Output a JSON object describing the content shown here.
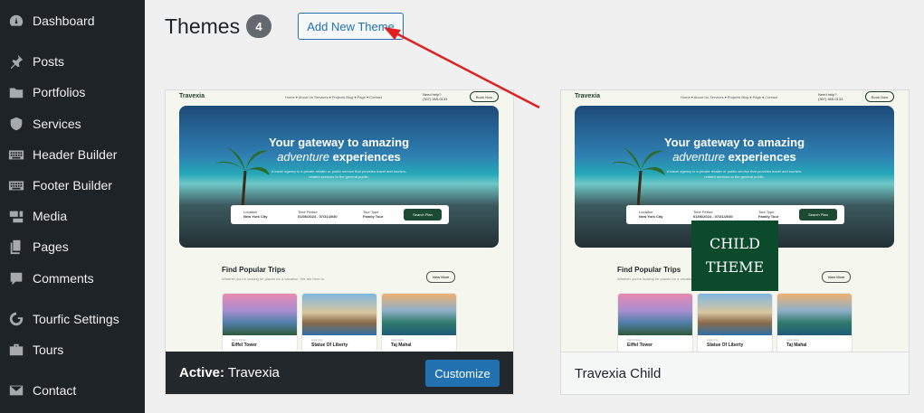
{
  "sidebar": {
    "items": [
      {
        "label": "Dashboard",
        "icon": "dashboard-icon"
      },
      {
        "label": "Posts",
        "icon": "pin-icon"
      },
      {
        "label": "Portfolios",
        "icon": "folder-icon"
      },
      {
        "label": "Services",
        "icon": "shield-icon"
      },
      {
        "label": "Header Builder",
        "icon": "keyboard-icon"
      },
      {
        "label": "Footer Builder",
        "icon": "keyboard-icon"
      },
      {
        "label": "Media",
        "icon": "media-icon"
      },
      {
        "label": "Pages",
        "icon": "pages-icon"
      },
      {
        "label": "Comments",
        "icon": "comment-icon"
      },
      {
        "label": "Tourfic Settings",
        "icon": "tourfic-icon"
      },
      {
        "label": "Tours",
        "icon": "briefcase-icon"
      },
      {
        "label": "Contact",
        "icon": "envelope-icon"
      }
    ]
  },
  "header": {
    "title": "Themes",
    "count": "4",
    "add_new_label": "Add New Theme"
  },
  "themes": [
    {
      "preview": {
        "logo": "Travexia",
        "nav_links": "Home ▾   About Us   Services ▾   Projects   Blog ▾   Page ▾   Contact",
        "help_label": "Need help?",
        "help_phone": "(307) 555-0133",
        "book_now": "Book Now",
        "hero_line1": "Your gateway to amazing",
        "hero_line2_italic": "adventure",
        "hero_line2": " experiences",
        "hero_sub": "A travel agency is a private retailer or public service that provides travel and tourism-related services to the general public.",
        "location_label": "Location",
        "location_value": "New York City",
        "time_label": "Time Period",
        "time_value": "01/06/2024 - 07/31/2030",
        "type_label": "Tour Type",
        "type_value": "Family Tour",
        "search_button": "Search Plan",
        "trips_title": "Find Popular Trips",
        "trips_sub": "Whether you're looking for places for a vacation. We are here to",
        "view_more": "View More",
        "cards": [
          {
            "category": "Kerry Ficus",
            "name": "Eiffel Tower"
          },
          {
            "category": "Agra City",
            "name": "Statue Of Liberty"
          },
          {
            "category": "Agra India",
            "name": "Taj Mahal"
          }
        ]
      },
      "active_prefix": "Active:",
      "name": "Travexia",
      "customize_label": "Customize"
    },
    {
      "name": "Travexia Child",
      "badge_line1": "CHILD",
      "badge_line2": "THEME"
    }
  ],
  "colors": {
    "sidebar_bg": "#1d2327",
    "accent": "#2271b1",
    "annotation_arrow": "#e02020",
    "child_badge": "#0c4a2c"
  }
}
